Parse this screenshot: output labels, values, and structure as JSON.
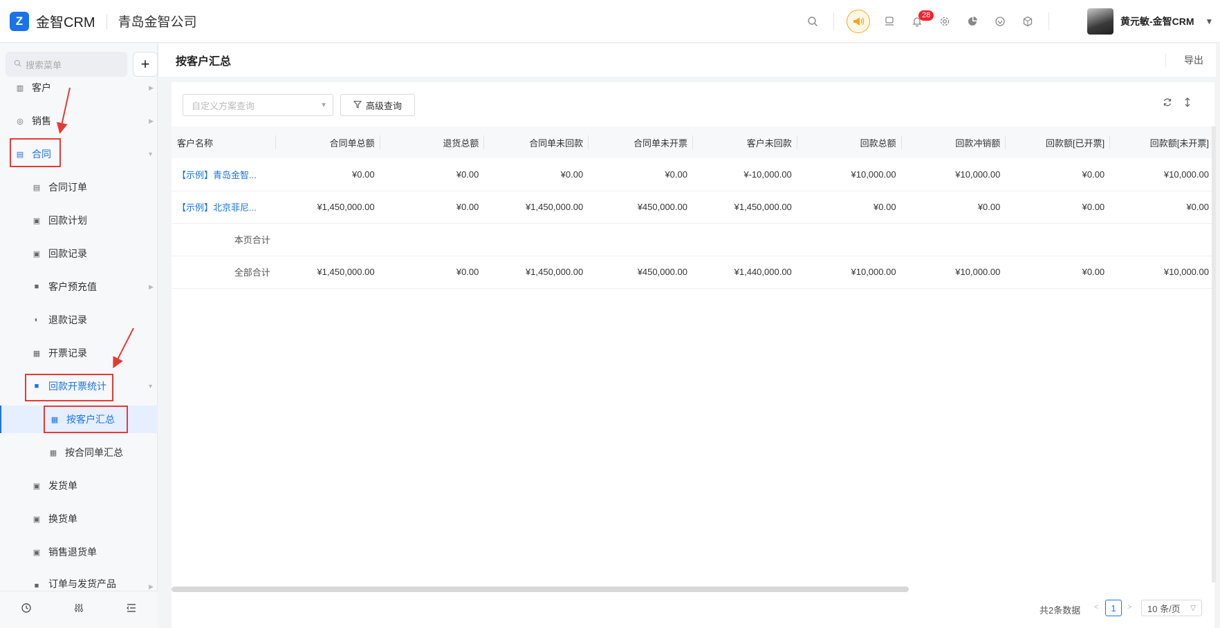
{
  "header": {
    "logo_letter": "Z",
    "app_title": "金智CRM",
    "company": "青岛金智公司",
    "notification_count": "28",
    "user_name": "黄元敏-金智CRM"
  },
  "sidebar": {
    "search_placeholder": "搜索菜单",
    "items": [
      {
        "label": "客户"
      },
      {
        "label": "销售"
      },
      {
        "label": "合同"
      },
      {
        "label": "合同订单"
      },
      {
        "label": "回款计划"
      },
      {
        "label": "回款记录"
      },
      {
        "label": "客户预充值"
      },
      {
        "label": "退款记录"
      },
      {
        "label": "开票记录"
      },
      {
        "label": "回款开票统计"
      },
      {
        "label": "按客户汇总"
      },
      {
        "label": "按合同单汇总"
      },
      {
        "label": "发货单"
      },
      {
        "label": "换货单"
      },
      {
        "label": "销售退货单"
      },
      {
        "label": "订单与发货产品"
      }
    ]
  },
  "page": {
    "title": "按客户汇总",
    "export_label": "导出",
    "scheme_placeholder": "自定义方案查询",
    "advanced_label": "高级查询"
  },
  "table": {
    "columns": [
      "客户名称",
      "合同单总额",
      "退货总额",
      "合同单未回款",
      "合同单未开票",
      "客户未回款",
      "回款总额",
      "回款冲销额",
      "回款额[已开票]",
      "回款额[未开票]"
    ],
    "rows": [
      {
        "name": "【示例】青岛金智...",
        "values": [
          "¥0.00",
          "¥0.00",
          "¥0.00",
          "¥0.00",
          "¥-10,000.00",
          "¥10,000.00",
          "¥10,000.00",
          "¥0.00",
          "¥10,000.00"
        ]
      },
      {
        "name": "【示例】北京菲尼...",
        "values": [
          "¥1,450,000.00",
          "¥0.00",
          "¥1,450,000.00",
          "¥450,000.00",
          "¥1,450,000.00",
          "¥0.00",
          "¥0.00",
          "¥0.00",
          "¥0.00"
        ]
      }
    ],
    "page_total_label": "本页合计",
    "all_total_label": "全部合计",
    "all_total_values": [
      "¥1,450,000.00",
      "¥0.00",
      "¥1,450,000.00",
      "¥450,000.00",
      "¥1,440,000.00",
      "¥10,000.00",
      "¥10,000.00",
      "¥0.00",
      "¥10,000.00"
    ]
  },
  "pagination": {
    "total_text": "共2条数据",
    "current_page": "1",
    "page_size": "10 条/页"
  },
  "colors": {
    "accent": "#1a73e8",
    "annotation": "#e53935",
    "broadcast": "#f5a623"
  }
}
